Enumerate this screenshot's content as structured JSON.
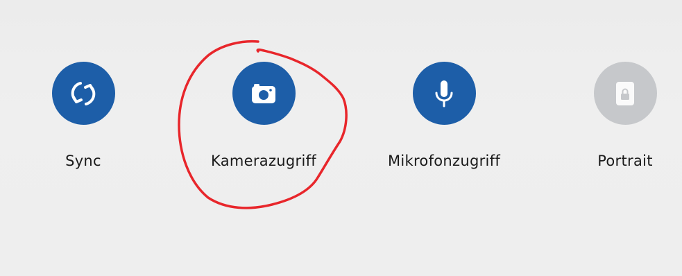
{
  "quick_settings": {
    "tiles": [
      {
        "label": "Sync",
        "icon": "sync-icon",
        "state": "on"
      },
      {
        "label": "Kamerazugriff",
        "icon": "camera-icon",
        "state": "on"
      },
      {
        "label": "Mikrofonzugriff",
        "icon": "microphone-icon",
        "state": "on"
      },
      {
        "label": "Portrait",
        "icon": "rotation-lock-icon",
        "state": "off"
      }
    ]
  },
  "colors": {
    "active": "#1d5ea8",
    "inactive": "#c6c8cb",
    "annotation": "#e8262b"
  }
}
